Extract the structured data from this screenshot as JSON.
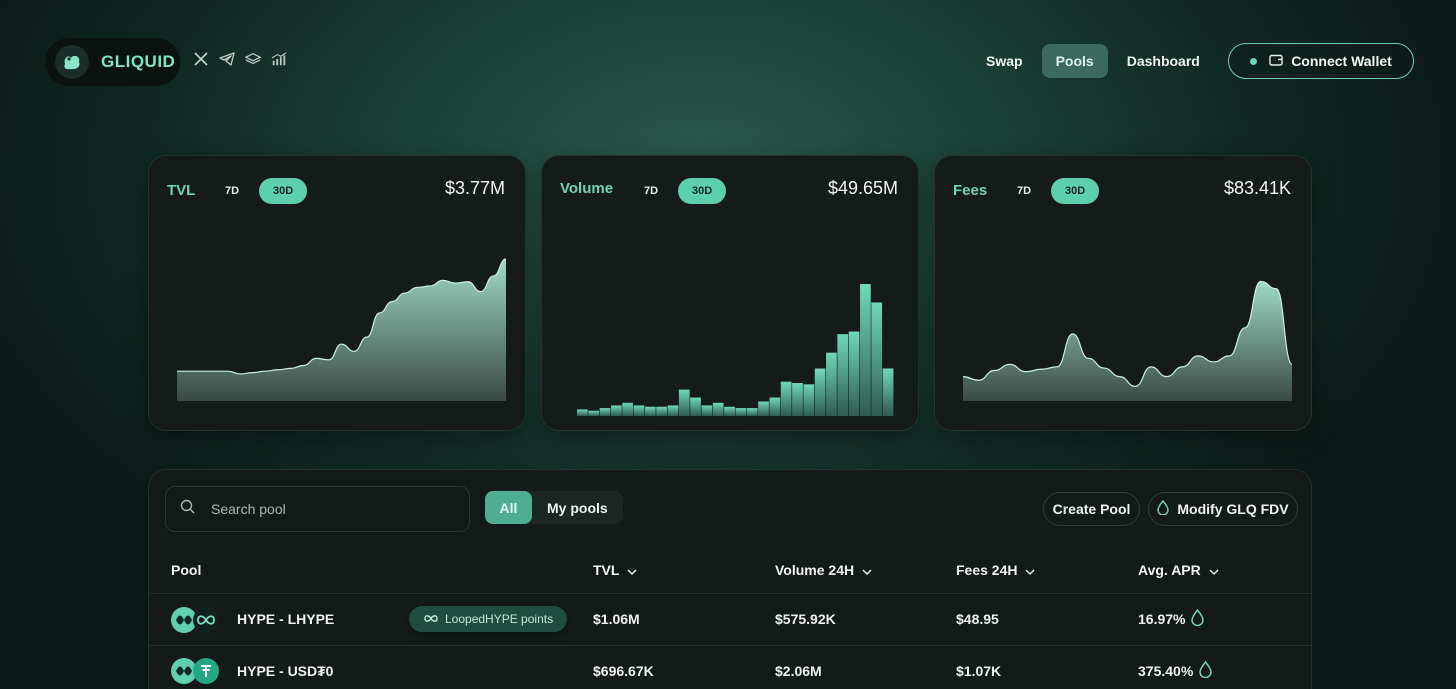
{
  "header": {
    "logo_text": "GLIQUID",
    "socials": [
      "x-icon",
      "telegram-icon",
      "docs-icon",
      "stats-icon"
    ],
    "nav": [
      {
        "label": "Swap",
        "active": false
      },
      {
        "label": "Pools",
        "active": true
      },
      {
        "label": "Dashboard",
        "active": false
      }
    ],
    "connect_label": "Connect Wallet"
  },
  "cards": [
    {
      "title": "TVL",
      "range_7d": "7D",
      "range_30d": "30D",
      "selected": "30D",
      "value": "$3.77M"
    },
    {
      "title": "Volume",
      "range_7d": "7D",
      "range_30d": "30D",
      "selected": "30D",
      "value": "$49.65M"
    },
    {
      "title": "Fees",
      "range_7d": "7D",
      "range_30d": "30D",
      "selected": "30D",
      "value": "$83.41K"
    }
  ],
  "chart_data": [
    {
      "type": "area",
      "name": "TVL",
      "values": [
        0.21,
        0.21,
        0.21,
        0.21,
        0.21,
        0.19,
        0.2,
        0.21,
        0.22,
        0.23,
        0.25,
        0.3,
        0.29,
        0.4,
        0.35,
        0.45,
        0.62,
        0.7,
        0.76,
        0.8,
        0.81,
        0.85,
        0.83,
        0.84,
        0.77,
        0.88,
        1.0
      ]
    },
    {
      "type": "bar",
      "name": "Volume",
      "values": [
        0.05,
        0.04,
        0.06,
        0.08,
        0.1,
        0.08,
        0.07,
        0.07,
        0.08,
        0.2,
        0.14,
        0.08,
        0.1,
        0.07,
        0.06,
        0.06,
        0.11,
        0.14,
        0.26,
        0.25,
        0.24,
        0.36,
        0.48,
        0.62,
        0.64,
        1.0,
        0.86,
        0.36
      ]
    },
    {
      "type": "area",
      "name": "Fees",
      "values": [
        0.2,
        0.17,
        0.25,
        0.3,
        0.24,
        0.26,
        0.28,
        0.55,
        0.35,
        0.27,
        0.2,
        0.12,
        0.28,
        0.2,
        0.28,
        0.37,
        0.32,
        0.37,
        0.6,
        0.98,
        0.92,
        0.3
      ]
    }
  ],
  "panel": {
    "search_placeholder": "Search pool",
    "filters": [
      {
        "label": "All",
        "active": true
      },
      {
        "label": "My pools",
        "active": false
      }
    ],
    "create_label": "Create Pool",
    "modify_label": "Modify GLQ FDV",
    "columns": [
      "Pool",
      "TVL",
      "Volume 24H",
      "Fees 24H",
      "Avg. APR"
    ],
    "rows": [
      {
        "pair": "HYPE - LHYPE",
        "badge": "LoopedHYPE points",
        "tvl": "$1.06M",
        "volume": "$575.92K",
        "fees": "$48.95",
        "apr": "16.97%"
      },
      {
        "pair": "HYPE - USD₮0",
        "badge": "",
        "tvl": "$696.67K",
        "volume": "$2.06M",
        "fees": "$1.07K",
        "apr": "375.40%"
      }
    ]
  },
  "colors": {
    "accent": "#5ccfac",
    "card_bg": "#141b19",
    "page_bg": "#0f2722"
  }
}
